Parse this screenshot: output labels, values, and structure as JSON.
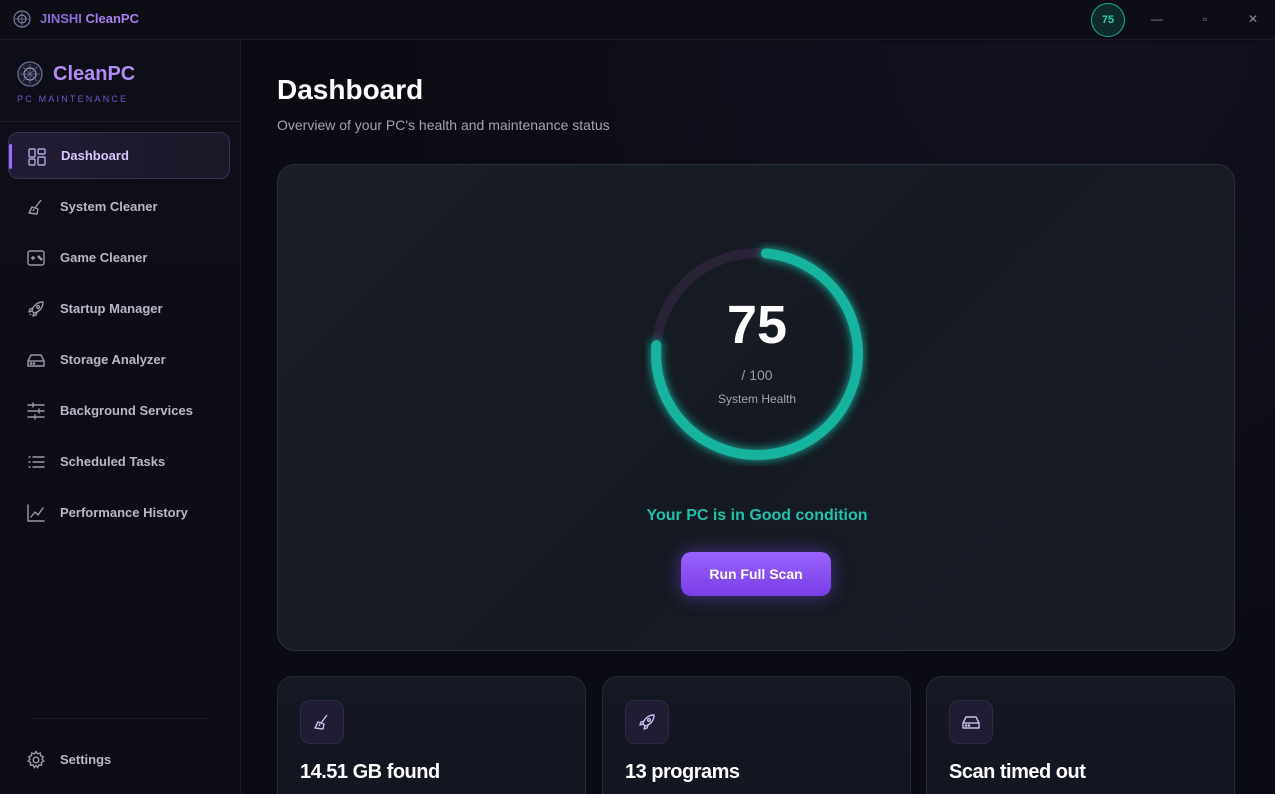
{
  "titlebar": {
    "app_name_part1": "JINSHI",
    "app_name_part2": "CleanPC",
    "health_badge": "75",
    "minimize": "—",
    "maximize": "▫",
    "close": "✕"
  },
  "sidebar": {
    "brand_name": "CleanPC",
    "brand_sub": "PC MAINTENANCE",
    "items": [
      {
        "label": "Dashboard",
        "icon": "dashboard-icon",
        "active": true
      },
      {
        "label": "System Cleaner",
        "icon": "broom-icon"
      },
      {
        "label": "Game Cleaner",
        "icon": "gamepad-icon"
      },
      {
        "label": "Startup Manager",
        "icon": "rocket-icon"
      },
      {
        "label": "Storage Analyzer",
        "icon": "hard-drive-icon"
      },
      {
        "label": "Background Services",
        "icon": "sliders-icon"
      },
      {
        "label": "Scheduled Tasks",
        "icon": "list-icon"
      },
      {
        "label": "Performance History",
        "icon": "chart-line-icon"
      }
    ],
    "settings_label": "Settings"
  },
  "main": {
    "title": "Dashboard",
    "subtitle": "Overview of your PC's health and maintenance status",
    "health": {
      "score": "75",
      "max": "/ 100",
      "label": "System Health",
      "fraction": 0.75,
      "condition": "Your PC is in Good condition",
      "scan_button": "Run Full Scan"
    },
    "stats": [
      {
        "icon": "broom-icon",
        "value": "14.51 GB found"
      },
      {
        "icon": "rocket-icon",
        "value": "13 programs"
      },
      {
        "icon": "hard-drive-icon",
        "value": "Scan timed out"
      }
    ]
  },
  "colors": {
    "accent": "#9a62ff",
    "health": "#18b39f",
    "background": "#0b0b13"
  }
}
